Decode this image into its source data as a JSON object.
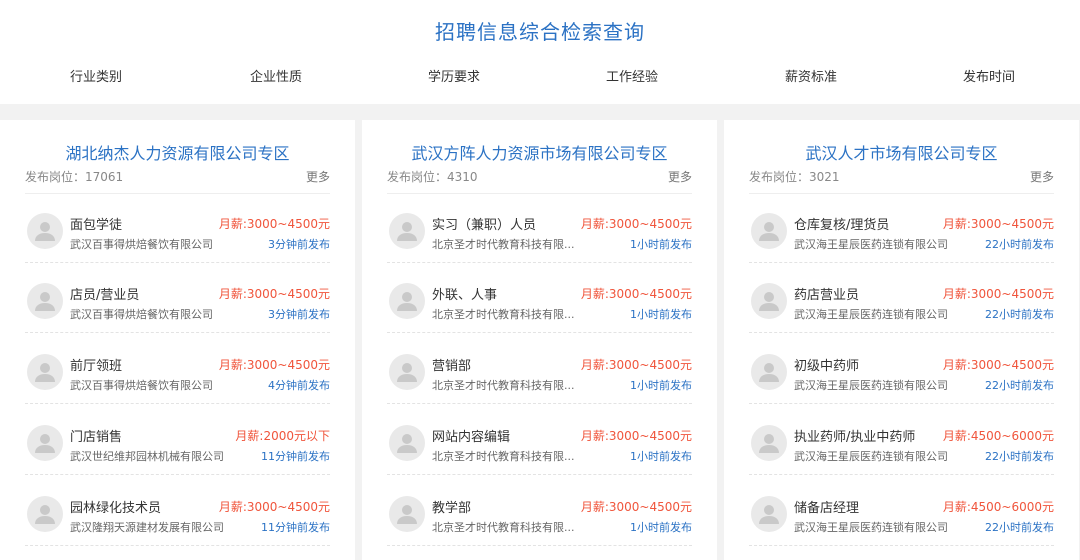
{
  "header": {
    "title": "招聘信息综合检索查询",
    "filters": [
      "行业类别",
      "企业性质",
      "学历要求",
      "工作经验",
      "薪资标准",
      "发布时间"
    ]
  },
  "columns": [
    {
      "title": "湖北纳杰人力资源有限公司专区",
      "count_label": "发布岗位：",
      "count": "17061",
      "more": "更多",
      "jobs": [
        {
          "title": "面包学徒",
          "salary": "月薪:3000~4500元",
          "company": "武汉百事得烘焙餐饮有限公司",
          "time": "3分钟前发布"
        },
        {
          "title": "店员/营业员",
          "salary": "月薪:3000~4500元",
          "company": "武汉百事得烘焙餐饮有限公司",
          "time": "3分钟前发布"
        },
        {
          "title": "前厅领班",
          "salary": "月薪:3000~4500元",
          "company": "武汉百事得烘焙餐饮有限公司",
          "time": "4分钟前发布"
        },
        {
          "title": "门店销售",
          "salary": "月薪:2000元以下",
          "company": "武汉世纪维邦园林机械有限公司",
          "time": "11分钟前发布"
        },
        {
          "title": "园林绿化技术员",
          "salary": "月薪:3000~4500元",
          "company": "武汉隆翔天源建材发展有限公司",
          "time": "11分钟前发布"
        }
      ]
    },
    {
      "title": "武汉方阵人力资源市场有限公司专区",
      "count_label": "发布岗位：",
      "count": "4310",
      "more": "更多",
      "jobs": [
        {
          "title": "实习（兼职）人员",
          "salary": "月薪:3000~4500元",
          "company": "北京圣才时代教育科技有限...",
          "time": "1小时前发布"
        },
        {
          "title": "外联、人事",
          "salary": "月薪:3000~4500元",
          "company": "北京圣才时代教育科技有限...",
          "time": "1小时前发布"
        },
        {
          "title": "营销部",
          "salary": "月薪:3000~4500元",
          "company": "北京圣才时代教育科技有限...",
          "time": "1小时前发布"
        },
        {
          "title": "网站内容编辑",
          "salary": "月薪:3000~4500元",
          "company": "北京圣才时代教育科技有限...",
          "time": "1小时前发布"
        },
        {
          "title": "教学部",
          "salary": "月薪:3000~4500元",
          "company": "北京圣才时代教育科技有限...",
          "time": "1小时前发布"
        }
      ]
    },
    {
      "title": "武汉人才市场有限公司专区",
      "count_label": "发布岗位：",
      "count": "3021",
      "more": "更多",
      "jobs": [
        {
          "title": "仓库复核/理货员",
          "salary": "月薪:3000~4500元",
          "company": "武汉海王星辰医药连锁有限公司",
          "time": "22小时前发布"
        },
        {
          "title": "药店营业员",
          "salary": "月薪:3000~4500元",
          "company": "武汉海王星辰医药连锁有限公司",
          "time": "22小时前发布"
        },
        {
          "title": "初级中药师",
          "salary": "月薪:3000~4500元",
          "company": "武汉海王星辰医药连锁有限公司",
          "time": "22小时前发布"
        },
        {
          "title": "执业药师/执业中药师",
          "salary": "月薪:4500~6000元",
          "company": "武汉海王星辰医药连锁有限公司",
          "time": "22小时前发布"
        },
        {
          "title": "储备店经理",
          "salary": "月薪:4500~6000元",
          "company": "武汉海王星辰医药连锁有限公司",
          "time": "22小时前发布"
        }
      ]
    }
  ]
}
